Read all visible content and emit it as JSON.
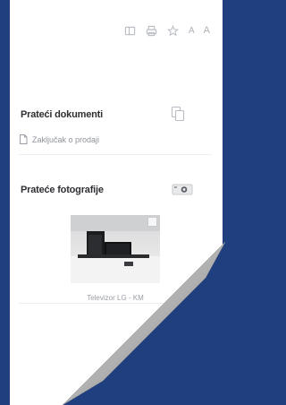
{
  "toolbar": {
    "icons": [
      "layout-icon",
      "print-icon",
      "star-icon"
    ],
    "font_small": "A",
    "font_large": "A"
  },
  "documents": {
    "title": "Prateći dokumenti",
    "items": [
      "Zaključak o prodaji"
    ]
  },
  "photos": {
    "title": "Prateće fotografije",
    "items": [
      {
        "caption": "Televizor LG - KM"
      }
    ]
  },
  "colors": {
    "background": "#1f3f7e",
    "panel": "#ffffff",
    "title": "#2e2f33",
    "muted": "#8f939b"
  }
}
